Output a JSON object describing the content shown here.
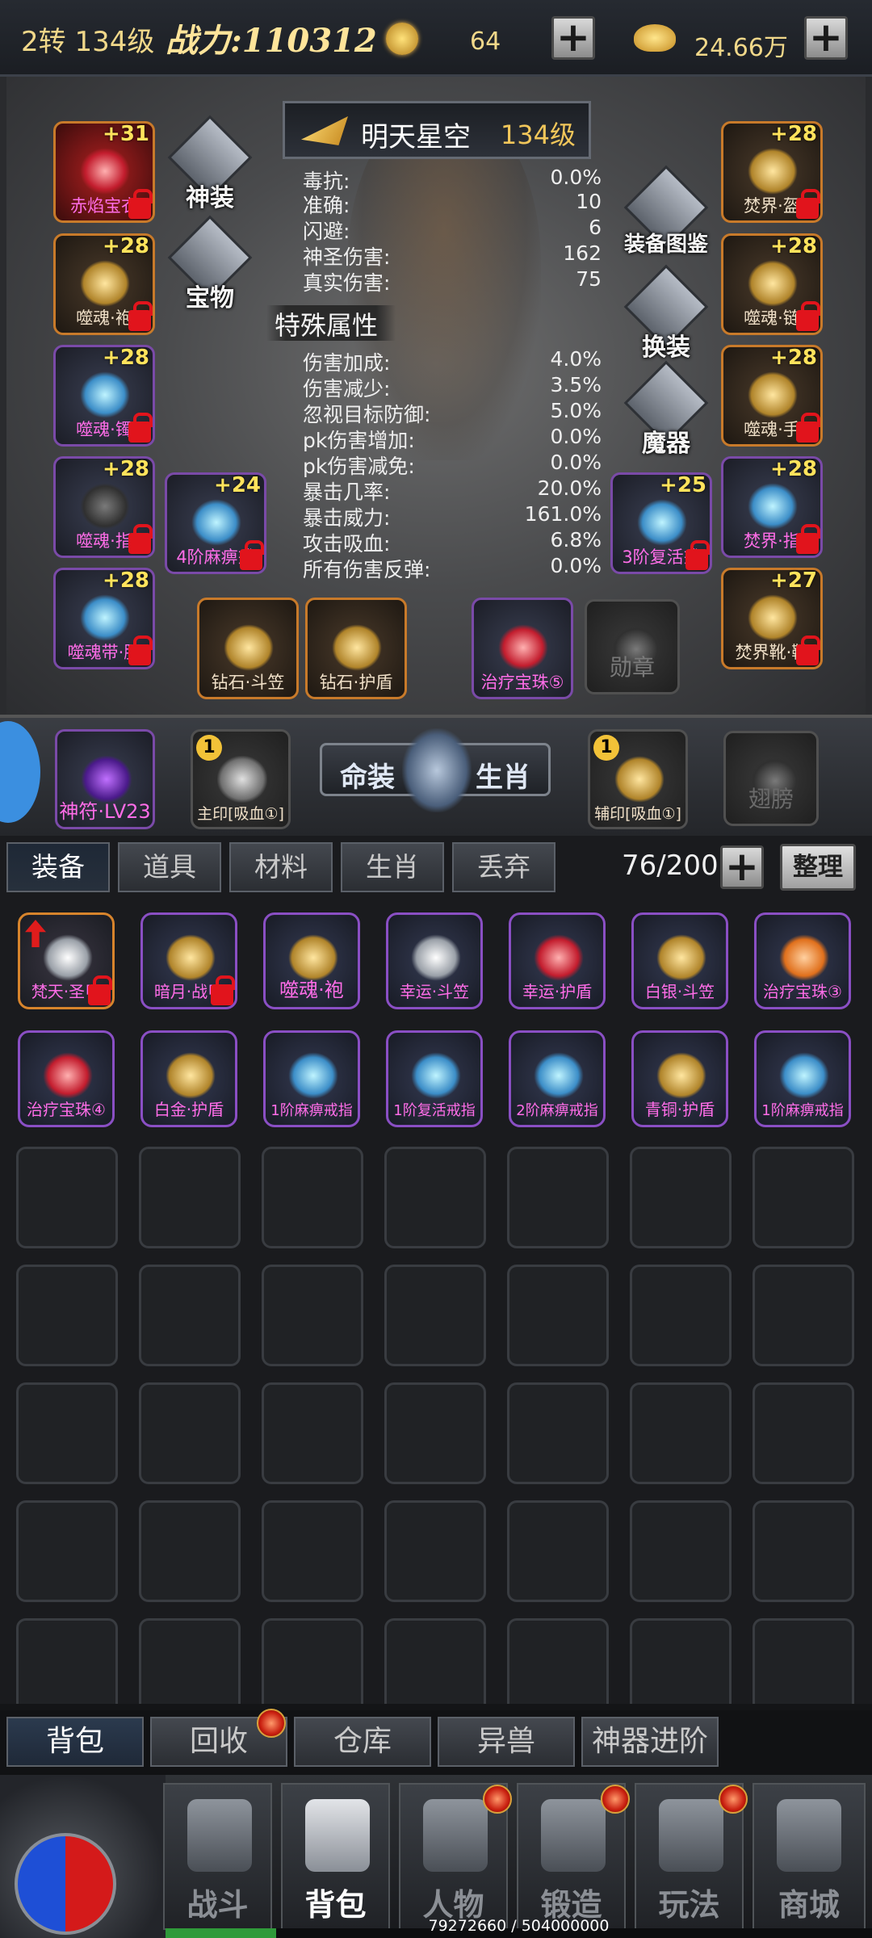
{
  "header": {
    "rebirth_level": "2转 134级",
    "power_label": "战力:",
    "power_value": "110312",
    "coins": "64",
    "gold": "24.66万"
  },
  "character": {
    "name": "明天星空",
    "level": "134级"
  },
  "stats": [
    {
      "k": "毒抗:",
      "v": "0.0%"
    },
    {
      "k": "准确:",
      "v": "10"
    },
    {
      "k": "闪避:",
      "v": "6"
    },
    {
      "k": "神圣伤害:",
      "v": "162"
    },
    {
      "k": "真实伤害:",
      "v": "75"
    }
  ],
  "special_title": "特殊属性",
  "special_stats": [
    {
      "k": "伤害加成:",
      "v": "4.0%"
    },
    {
      "k": "伤害减少:",
      "v": "3.5%"
    },
    {
      "k": "忽视目标防御:",
      "v": "5.0%"
    },
    {
      "k": "pk伤害增加:",
      "v": "0.0%"
    },
    {
      "k": "pk伤害减免:",
      "v": "0.0%"
    },
    {
      "k": "暴击几率:",
      "v": "20.0%"
    },
    {
      "k": "暴击威力:",
      "v": "161.0%"
    },
    {
      "k": "攻击吸血:",
      "v": "6.8%"
    },
    {
      "k": "所有伤害反弹:",
      "v": "0.0%"
    }
  ],
  "side_buttons": {
    "shenzhuang": "神装",
    "baowu": "宝物",
    "tujian": "装备图鉴",
    "huanzhuang": "换装",
    "moqi": "魔器"
  },
  "equip_left": [
    {
      "plus": "+31",
      "label": "赤焰宝衣"
    },
    {
      "plus": "+28",
      "label": "噬魂·袍"
    },
    {
      "plus": "+28",
      "label": "噬魂·镯"
    },
    {
      "plus": "+28",
      "label": "噬魂·指"
    },
    {
      "plus": "+28",
      "label": "噬魂带·腰"
    }
  ],
  "equip_right": [
    {
      "plus": "+28",
      "label": "焚界·盔"
    },
    {
      "plus": "+28",
      "label": "噬魂·链"
    },
    {
      "plus": "+28",
      "label": "噬魂·手"
    },
    {
      "plus": "+28",
      "label": "焚界·指"
    },
    {
      "plus": "+27",
      "label": "焚界靴·靴"
    }
  ],
  "equip_inner": [
    {
      "plus": "+24",
      "label": "4阶麻痹戒"
    },
    {
      "plus": "+25",
      "label": "3阶复活戒"
    }
  ],
  "equip_bottom": [
    {
      "label": "钻石·斗笠"
    },
    {
      "label": "钻石·护盾"
    },
    {
      "label": "治疗宝珠⑤"
    },
    {
      "label": "勋章"
    }
  ],
  "mid": {
    "rune": "神符·LV23",
    "seal_num": "1",
    "main_seal": "主印[吸血①]",
    "aux_seal": "辅印[吸血①]",
    "mingzhuang": "命装",
    "shengxiao": "生肖",
    "wings": "翅膀"
  },
  "inventory": {
    "tabs": [
      "装备",
      "道具",
      "材料",
      "生肖",
      "丢弃"
    ],
    "capacity": "76/200",
    "sort_label": "整理",
    "items": [
      {
        "label": "梵天·圣甲"
      },
      {
        "label": "暗月·战甲"
      },
      {
        "label": "噬魂·袍"
      },
      {
        "label": "幸运·斗笠"
      },
      {
        "label": "幸运·护盾"
      },
      {
        "label": "白银·斗笠"
      },
      {
        "label": "治疗宝珠③"
      },
      {
        "label": "治疗宝珠④"
      },
      {
        "label": "白金·护盾"
      },
      {
        "label": "1阶麻痹戒指"
      },
      {
        "label": "1阶复活戒指"
      },
      {
        "label": "2阶麻痹戒指"
      },
      {
        "label": "青铜·护盾"
      },
      {
        "label": "1阶麻痹戒指"
      }
    ]
  },
  "subtabs": [
    "背包",
    "回收",
    "仓库",
    "异兽",
    "神器进阶"
  ],
  "nav": [
    "战斗",
    "背包",
    "人物",
    "锻造",
    "玩法",
    "商城"
  ],
  "exp": {
    "text": "79272660 / 504000000",
    "fraction": 0.157
  },
  "colors": {
    "gold": "#f2c14e",
    "purple_border": "#8a4fc4",
    "orange_border": "#d7842c",
    "pink_label": "#ff6de8",
    "red_lock": "#e1141c"
  },
  "icons": {
    "coin": "spiral-coin-icon",
    "gold": "gold-ingot-icon",
    "plus": "plus-icon",
    "lock": "lock-icon"
  }
}
